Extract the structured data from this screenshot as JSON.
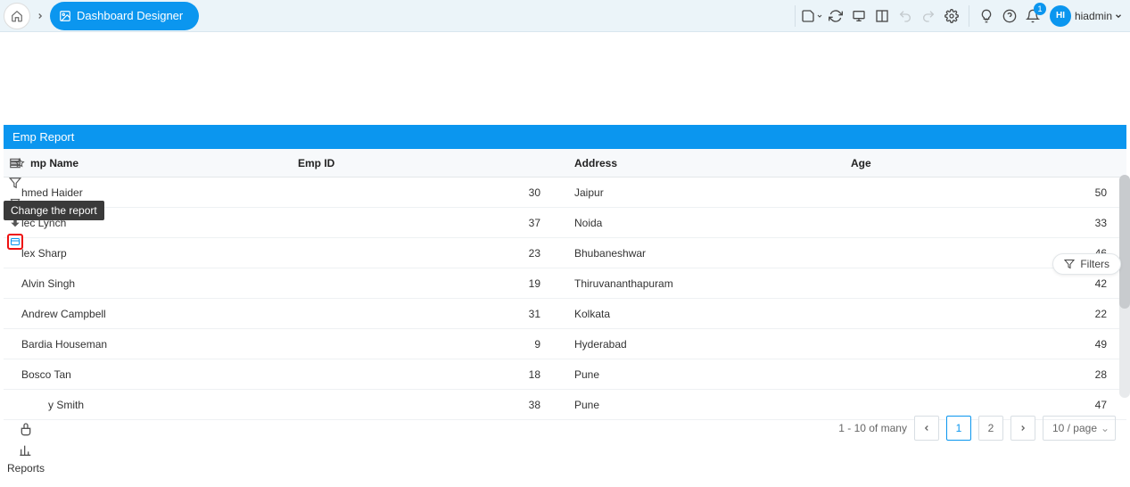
{
  "topbar": {
    "breadcrumb_label": "Dashboard Designer",
    "avatar_initials": "HI",
    "username": "hiadmin",
    "notif_count": "1"
  },
  "report": {
    "title": "Emp Report",
    "headers": {
      "name": "mp Name",
      "id": "Emp ID",
      "address": "Address",
      "age": "Age"
    },
    "rows": [
      {
        "name": "hmed Haider",
        "id": "30",
        "address": "Jaipur",
        "age": "50"
      },
      {
        "name": "lec Lynch",
        "id": "37",
        "address": "Noida",
        "age": "33"
      },
      {
        "name": "lex Sharp",
        "id": "23",
        "address": "Bhubaneshwar",
        "age": "46"
      },
      {
        "name": "Alvin Singh",
        "id": "19",
        "address": "Thiruvananthapuram",
        "age": "42"
      },
      {
        "name": "Andrew Campbell",
        "id": "31",
        "address": "Kolkata",
        "age": "22"
      },
      {
        "name": "Bardia Houseman",
        "id": "9",
        "address": "Hyderabad",
        "age": "49"
      },
      {
        "name": "Bosco Tan",
        "id": "18",
        "address": "Pune",
        "age": "28"
      },
      {
        "name": "y Smith",
        "id": "38",
        "address": "Pune",
        "age": "47"
      }
    ]
  },
  "tooltip": {
    "text": "Change the report"
  },
  "filters": {
    "label": "Filters"
  },
  "pagination": {
    "range_text": "1 - 10 of many",
    "page_1": "1",
    "page_2": "2",
    "page_size": "10 / page"
  },
  "bottom_left": {
    "label": "Reports"
  }
}
